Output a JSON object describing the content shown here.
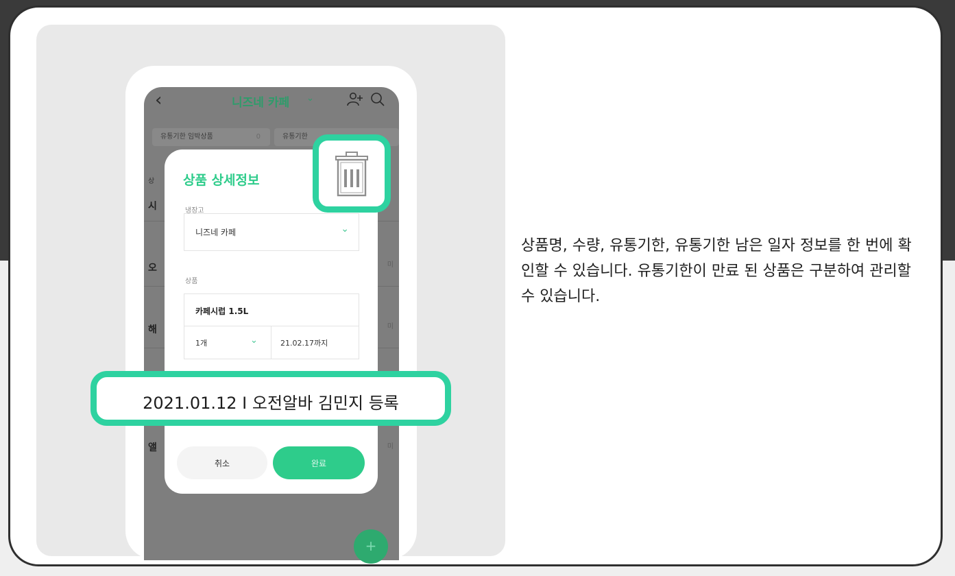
{
  "header": {
    "title": "니즈네 카페",
    "back_icon": "back-arrow-icon",
    "chevron_icon": "chevron-down-icon",
    "add_user_icon": "add-user-icon",
    "search_icon": "search-icon"
  },
  "filters": [
    {
      "label": "유통기한 임박상품",
      "count": "0"
    },
    {
      "label": "유통기한 ",
      "count": ""
    }
  ],
  "background_rows": [
    {
      "letter": "상"
    },
    {
      "letter": "시"
    },
    {
      "letter": "오"
    },
    {
      "letter": "해"
    },
    {
      "letter": "앨"
    }
  ],
  "modal": {
    "title": "상품 상세정보",
    "fridge_label": "냉장고",
    "fridge_value": "니즈네 카페",
    "product_label": "상품",
    "product_name": "카페시럽 1.5L",
    "quantity": "1개",
    "expiry": "21.02.17까지",
    "cancel_label": "취소",
    "done_label": "완료",
    "delete_icon": "trash-icon"
  },
  "registration_info": "2021.01.12 I 오전알바 김민지 등록",
  "fab": {
    "label": "+",
    "icon": "plus-icon"
  },
  "description": "상품명, 수량, 유통기한, 유통기한 남은 일자 정보를 한 번에 확인할 수 있습니다. 유통기한이 만료 된 상품은 구분하여 관리할 수 있습니다.",
  "colors": {
    "accent": "#2ecc8b",
    "highlight": "#2ed2a0",
    "brand_dark": "#2e9c6b",
    "border": "#2f2f2f"
  }
}
